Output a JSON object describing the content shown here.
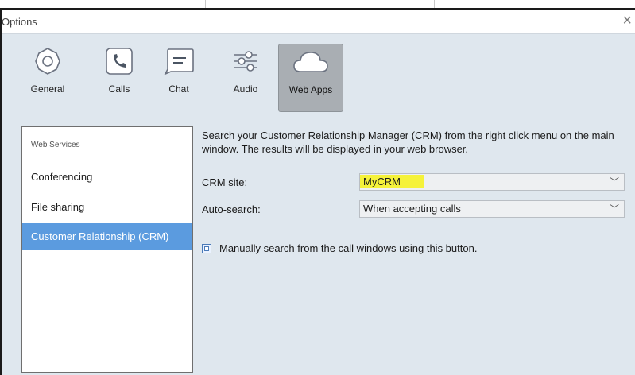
{
  "window": {
    "title": "Options",
    "close_glyph": "×"
  },
  "toolbar": {
    "items": [
      {
        "label": "General",
        "icon": "gear-icon"
      },
      {
        "label": "Calls",
        "icon": "phone-icon"
      },
      {
        "label": "Chat",
        "icon": "chat-icon"
      },
      {
        "label": "Audio",
        "icon": "sliders-icon"
      },
      {
        "label": "Web Apps",
        "icon": "cloud-icon",
        "active": true
      }
    ]
  },
  "sidebar": {
    "heading": "Web Services",
    "items": [
      {
        "label": "Conferencing"
      },
      {
        "label": "File sharing"
      },
      {
        "label": "Customer Relationship (CRM)",
        "selected": true
      }
    ]
  },
  "crm": {
    "description": "Search your Customer Relationship Manager (CRM) from the right click menu on the main window. The results will be displayed in your web browser.",
    "site_label": "CRM site:",
    "site_value": "MyCRM",
    "autosearch_label": "Auto-search:",
    "autosearch_value": "When accepting calls",
    "manual_text": "Manually search from the call windows using this button."
  },
  "colors": {
    "selection": "#5b9bdf",
    "highlight": "#f5f23a",
    "background": "#dfe7ee"
  }
}
